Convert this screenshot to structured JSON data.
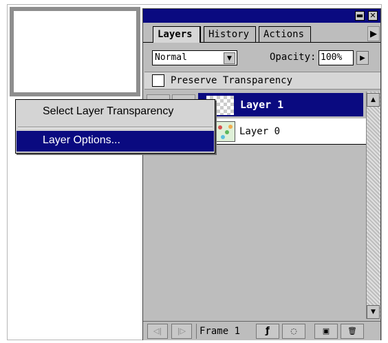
{
  "palette": {
    "title_buttons": {
      "minimize": "▬",
      "close": "✕"
    },
    "tabs": [
      {
        "label": "Layers",
        "active": true
      },
      {
        "label": "History",
        "active": false
      },
      {
        "label": "Actions",
        "active": false
      }
    ],
    "tab_menu_arrow": "▶",
    "blend_mode": {
      "value": "Normal"
    },
    "opacity": {
      "label": "Opacity:",
      "value": "100%"
    },
    "preserve_transparency": {
      "label": "Preserve Transparency",
      "checked": false
    },
    "layers": [
      {
        "name": "Layer 1",
        "selected": true
      },
      {
        "name": "Layer 0",
        "selected": false
      }
    ],
    "bottom_bar": {
      "prev_frame": "◁|",
      "next_frame": "|▷",
      "frame_label": "Frame 1",
      "fx_icon": "ƒ",
      "mask_icon": "◌",
      "new_layer_icon": "▣",
      "trash_icon": "🗑"
    }
  },
  "context_menu": {
    "items": [
      {
        "label": "Select Layer Transparency",
        "highlighted": false
      },
      {
        "label": "Layer Options...",
        "highlighted": true
      }
    ]
  },
  "colors": {
    "title_bar": "#0a0a80",
    "selection": "#0a0a80",
    "panel": "#bdbdbd"
  }
}
